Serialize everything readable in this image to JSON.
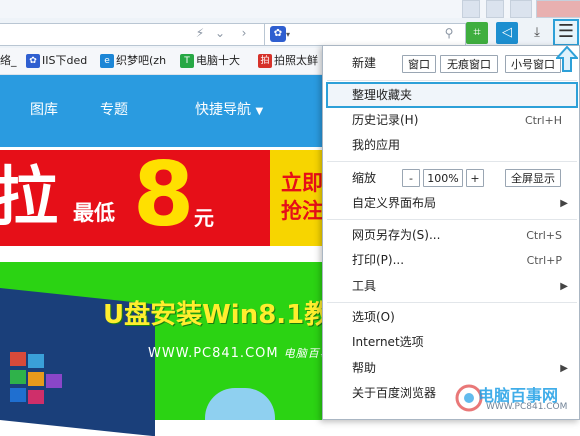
{
  "browser": {
    "search_engine_icon": "paw-icon",
    "toolbar_icons": [
      "crop-icon",
      "share-icon",
      "download-icon"
    ],
    "menu_icon": "hamburger-menu-icon",
    "accent_color": "#2da0d8"
  },
  "bookmarks": [
    {
      "label": "络_",
      "icon": ""
    },
    {
      "label": "IIS下ded",
      "icon": "paw-icon"
    },
    {
      "label": "织梦吧(zh",
      "icon": "e-icon"
    },
    {
      "label": "电脑十大",
      "icon": "t-icon"
    },
    {
      "label": "拍照太鲜",
      "icon": "pc-icon"
    }
  ],
  "page": {
    "nav": [
      "图库",
      "专题",
      "快捷导航"
    ],
    "banner": {
      "big_char": "拉",
      "lowest": "最低",
      "eight": "8",
      "yuan": "元",
      "right_line1": "立即",
      "right_line2": "抢注"
    },
    "promo_title": "U盘安装Win8.1教",
    "promo_url": "WWW.PC841.COM",
    "promo_url_suffix": "电脑百事网"
  },
  "menu": {
    "new_label": "新建",
    "new_window": "窗口",
    "incognito_window": "无痕窗口",
    "small_window": "小号窗口",
    "items": [
      {
        "label": "整理收藏夹",
        "shortcut": "",
        "highlighted": true
      },
      {
        "label": "历史记录(H)",
        "shortcut": "Ctrl+H"
      },
      {
        "label": "我的应用",
        "shortcut": ""
      },
      {
        "label": "自定义界面布局",
        "shortcut": "",
        "submenu": true
      },
      {
        "label": "网页另存为(S)...",
        "shortcut": "Ctrl+S"
      },
      {
        "label": "打印(P)...",
        "shortcut": "Ctrl+P"
      },
      {
        "label": "工具",
        "shortcut": "",
        "submenu": true
      },
      {
        "label": "选项(O)",
        "shortcut": ""
      },
      {
        "label": "Internet选项",
        "shortcut": ""
      },
      {
        "label": "帮助",
        "shortcut": "",
        "submenu": true
      },
      {
        "label": "关于百度浏览器",
        "shortcut": ""
      }
    ],
    "zoom_label": "缩放",
    "zoom_minus": "-",
    "zoom_value": "100%",
    "zoom_plus": "+",
    "fullscreen": "全屏显示"
  },
  "watermark": {
    "text": "电脑百事网",
    "url": "WWW.PC841.COM"
  }
}
